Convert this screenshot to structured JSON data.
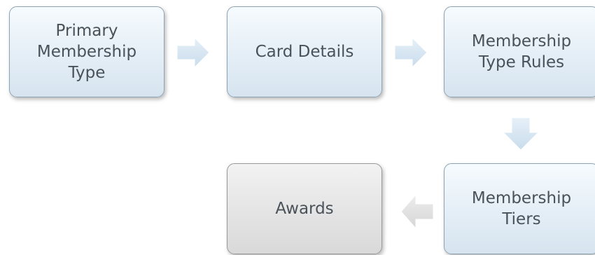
{
  "nodes": {
    "primary_membership_type": "Primary\nMembership\nType",
    "card_details": "Card Details",
    "membership_type_rules": "Membership\nType Rules",
    "membership_tiers": "Membership\nTiers",
    "awards": "Awards"
  },
  "colors": {
    "node_blue_fill": "#e4eef6",
    "node_gray_fill": "#e4e4e4",
    "arrow_blue_fill": "#d4e4f1",
    "arrow_gray_fill": "#e2e2e2",
    "text": "#4a5259"
  }
}
